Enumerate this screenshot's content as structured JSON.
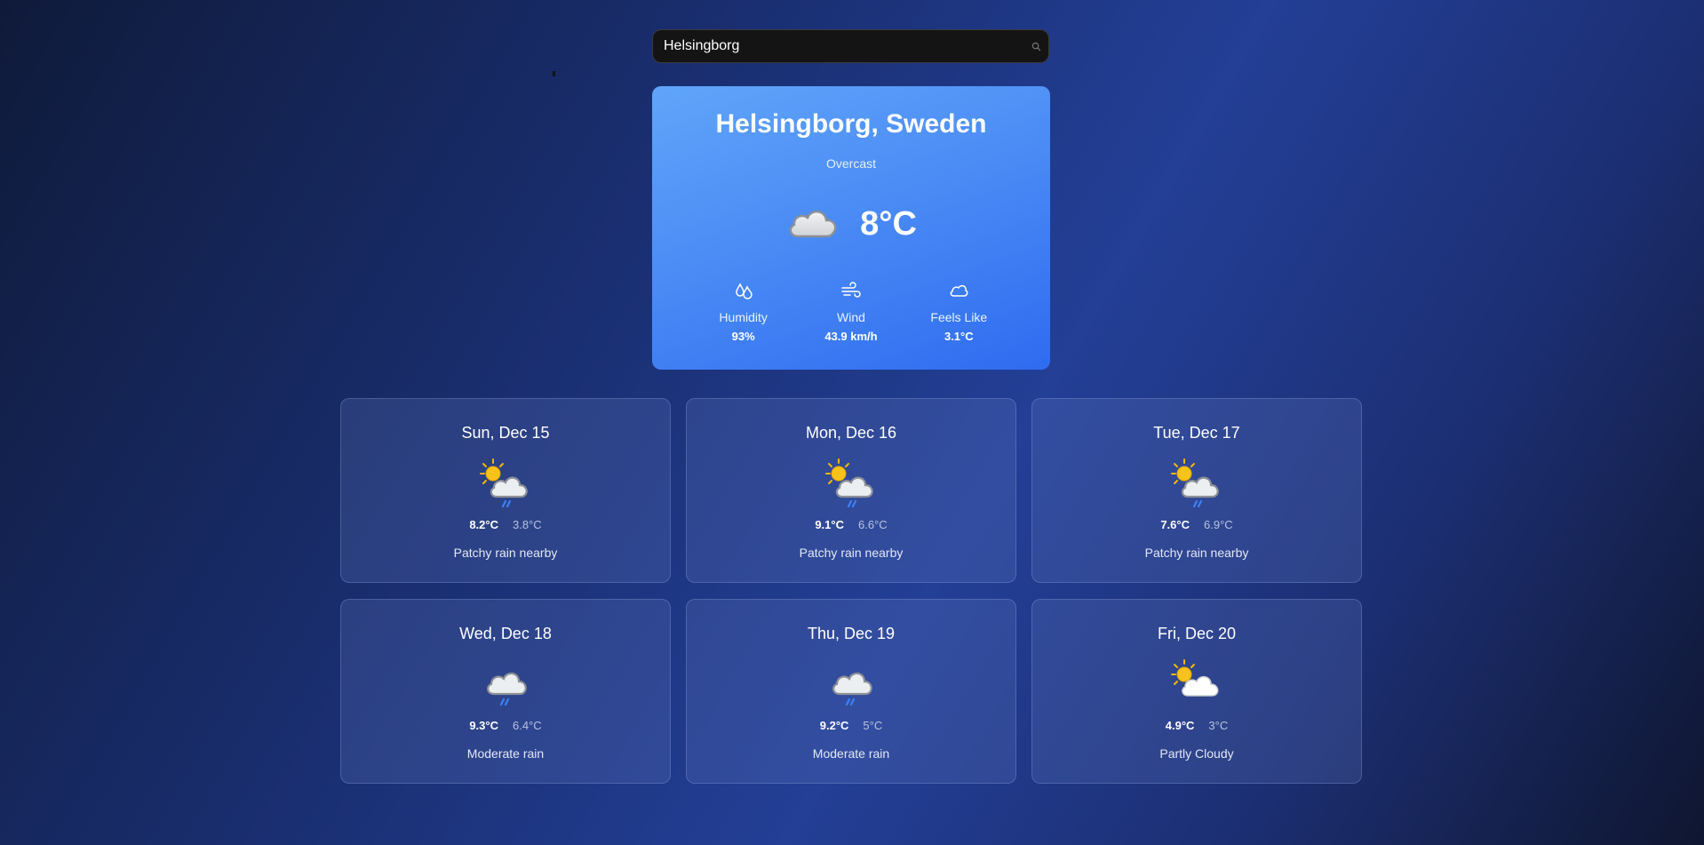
{
  "search": {
    "value": "Helsingborg",
    "placeholder": ""
  },
  "current": {
    "location": "Helsingborg, Sweden",
    "condition": "Overcast",
    "temperature": "8°C",
    "icon": "cloud-icon",
    "stats": [
      {
        "icon": "humidity-icon",
        "label": "Humidity",
        "value": "93%"
      },
      {
        "icon": "wind-icon",
        "label": "Wind",
        "value": "43.9 km/h"
      },
      {
        "icon": "feels-like-cloud-icon",
        "label": "Feels Like",
        "value": "3.1°C"
      }
    ]
  },
  "forecast": [
    {
      "date": "Sun, Dec 15",
      "high": "8.2°C",
      "low": "3.8°C",
      "condition": "Patchy rain nearby",
      "icon": "sun-cloud-rain-icon"
    },
    {
      "date": "Mon, Dec 16",
      "high": "9.1°C",
      "low": "6.6°C",
      "condition": "Patchy rain nearby",
      "icon": "sun-cloud-rain-icon"
    },
    {
      "date": "Tue, Dec 17",
      "high": "7.6°C",
      "low": "6.9°C",
      "condition": "Patchy rain nearby",
      "icon": "sun-cloud-rain-icon"
    },
    {
      "date": "Wed, Dec 18",
      "high": "9.3°C",
      "low": "6.4°C",
      "condition": "Moderate rain",
      "icon": "cloud-rain-icon"
    },
    {
      "date": "Thu, Dec 19",
      "high": "9.2°C",
      "low": "5°C",
      "condition": "Moderate rain",
      "icon": "cloud-rain-icon"
    },
    {
      "date": "Fri, Dec 20",
      "high": "4.9°C",
      "low": "3°C",
      "condition": "Partly Cloudy",
      "icon": "sun-cloud-icon"
    }
  ],
  "colors": {
    "card_gradient_start": "#60a5fa",
    "card_gradient_end": "#2f6bf0",
    "rain": "#3b82f6",
    "sun": "#f5b800"
  }
}
